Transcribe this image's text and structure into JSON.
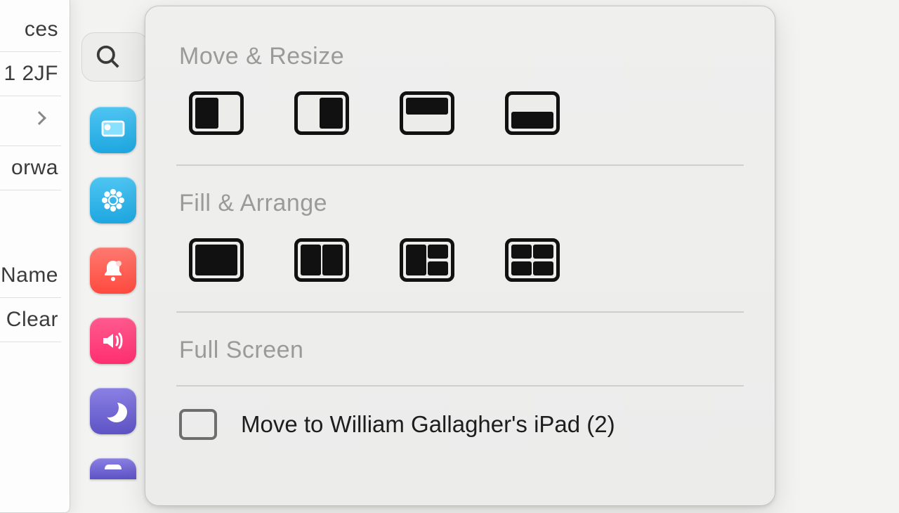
{
  "background_window": {
    "rows": [
      "ces",
      "1 2JF",
      "orwa",
      "Name",
      "Clear"
    ]
  },
  "sidebar_apps": [
    {
      "name": "screensaver-app",
      "color": "#33b8f0"
    },
    {
      "name": "photos-app",
      "color": "#33b8f0"
    },
    {
      "name": "notifications-app",
      "color": "#ff5a52"
    },
    {
      "name": "sound-app",
      "color": "#ff3b77"
    },
    {
      "name": "focus-app",
      "color": "#6d61d6"
    },
    {
      "name": "screen-time-app",
      "color": "#6d61d6"
    }
  ],
  "popover": {
    "sections": {
      "move_resize": "Move & Resize",
      "fill_arrange": "Fill & Arrange",
      "full_screen": "Full Screen"
    },
    "move_resize_options": [
      "left-half",
      "right-half",
      "top-half",
      "bottom-half"
    ],
    "fill_arrange_options": [
      "fill-screen",
      "two-up",
      "three-up",
      "quarters"
    ],
    "full_screen_item": "Move to William Gallagher's iPad (2)"
  }
}
